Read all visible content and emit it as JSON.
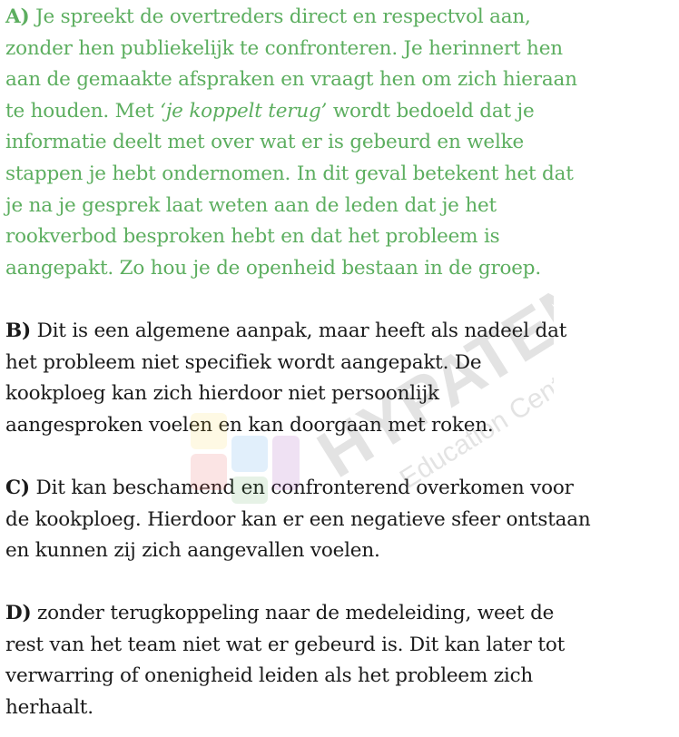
{
  "answers": [
    {
      "letter": "A)",
      "color": "#5cae5f",
      "lines": [
        [
          " Je spreekt de overtreders direct en respectvol aan,"
        ],
        [
          "zonder hen publiekelijk te confronteren. Je herinnert hen"
        ],
        [
          "aan de gemaakte afspraken en vraagt hen om zich hieraan"
        ],
        [
          "te houden. Met ",
          "‘je koppelt terug’",
          " wordt bedoeld dat je"
        ],
        [
          "informatie deelt met  over wat er is gebeurd en welke"
        ],
        [
          "stappen je hebt ondernomen. In dit geval betekent het dat"
        ],
        [
          "je na je gesprek laat weten aan de leden dat je het"
        ],
        [
          "rookverbod besproken hebt en dat het probleem is"
        ],
        [
          "aangepakt. Zo hou je de openheid bestaan in de groep."
        ]
      ]
    },
    {
      "letter": "B)",
      "color": "#1a1a1a",
      "lines": [
        [
          " Dit is een algemene aanpak, maar heeft als nadeel dat"
        ],
        [
          "het probleem niet specifiek wordt aangepakt. De"
        ],
        [
          "kookploeg kan zich hierdoor niet persoonlijk"
        ],
        [
          "aangesproken voelen en kan doorgaan met roken."
        ]
      ]
    },
    {
      "letter": "C)",
      "color": "#1a1a1a",
      "lines": [
        [
          " Dit kan beschamend en confronterend overkomen voor"
        ],
        [
          "de kookploeg. Hierdoor kan er een negatieve sfeer ontstaan"
        ],
        [
          "en kunnen zij zich aangevallen voelen."
        ]
      ]
    },
    {
      "letter": "D)",
      "color": "#1a1a1a",
      "lines": [
        [
          " zonder terugkoppeling naar de medeleiding, weet de"
        ],
        [
          "rest van het team niet wat er gebeurd is. Dit kan later tot"
        ],
        [
          "verwarring of onenigheid leiden als het probleem zich"
        ],
        [
          "herhaalt."
        ]
      ]
    }
  ],
  "watermark": {
    "brand": "HYPATEN",
    "tagline": "Education Center"
  }
}
